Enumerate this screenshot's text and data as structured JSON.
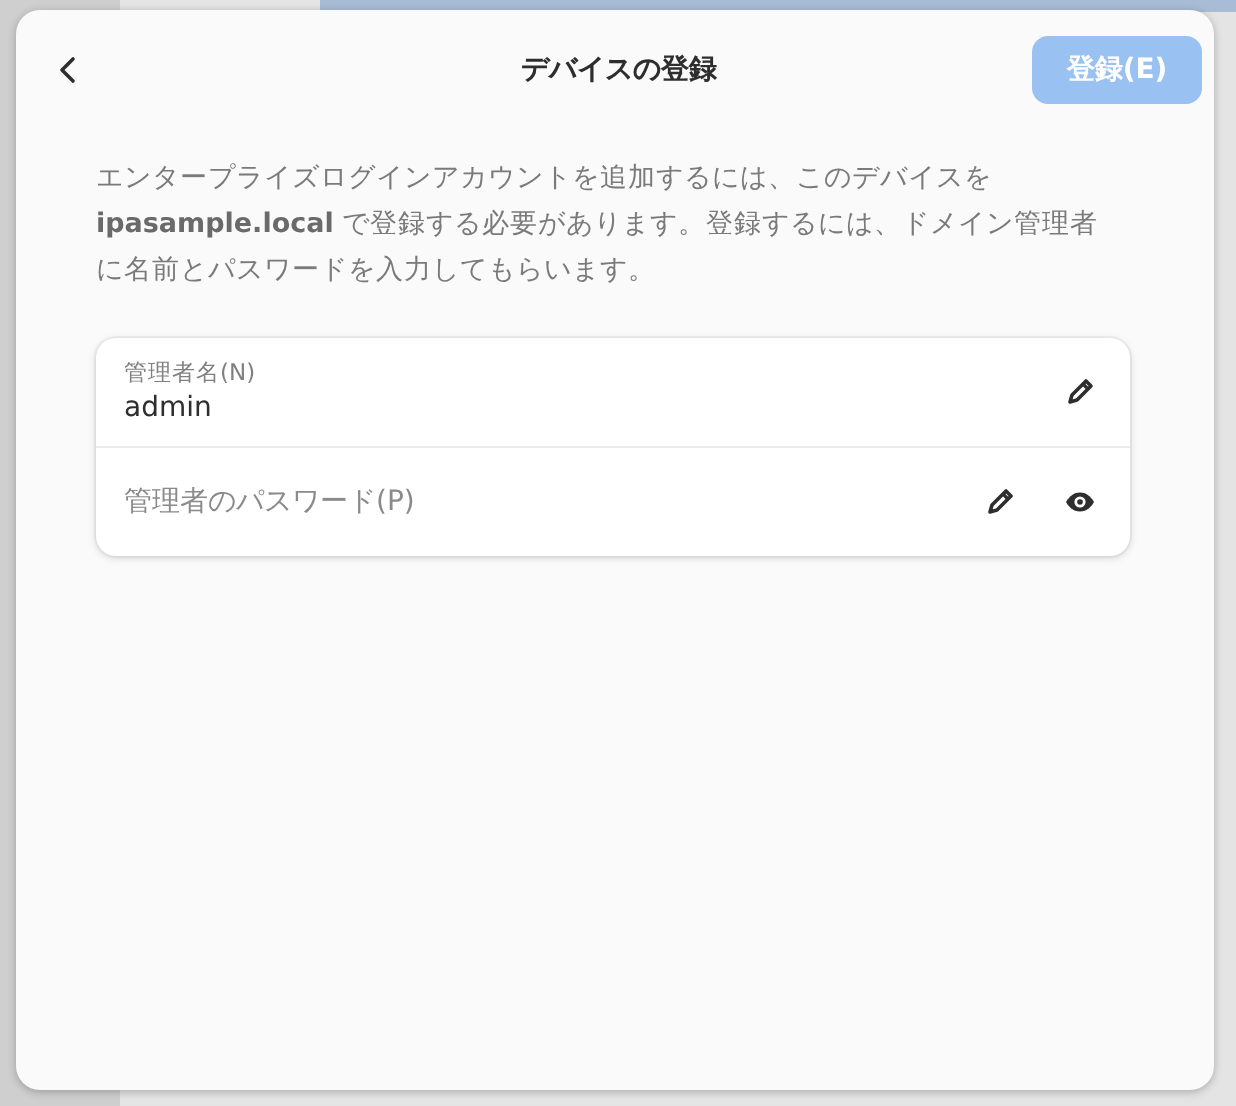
{
  "dialog": {
    "title": "デバイスの登録",
    "register_button": {
      "label": "登録(E)",
      "disabled": true
    },
    "description": "エンタープライズログインアカウントを追加するには、このデバイスを **ipasample.local** で登録する必要があります。登録するには、ドメイン管理者に名前とパスワードを入力してもらいます。",
    "fields": [
      {
        "kind": "entry",
        "label": "管理者名(N)",
        "value": "admin"
      },
      {
        "kind": "password",
        "placeholder": "管理者のパスワード(P)"
      }
    ]
  }
}
